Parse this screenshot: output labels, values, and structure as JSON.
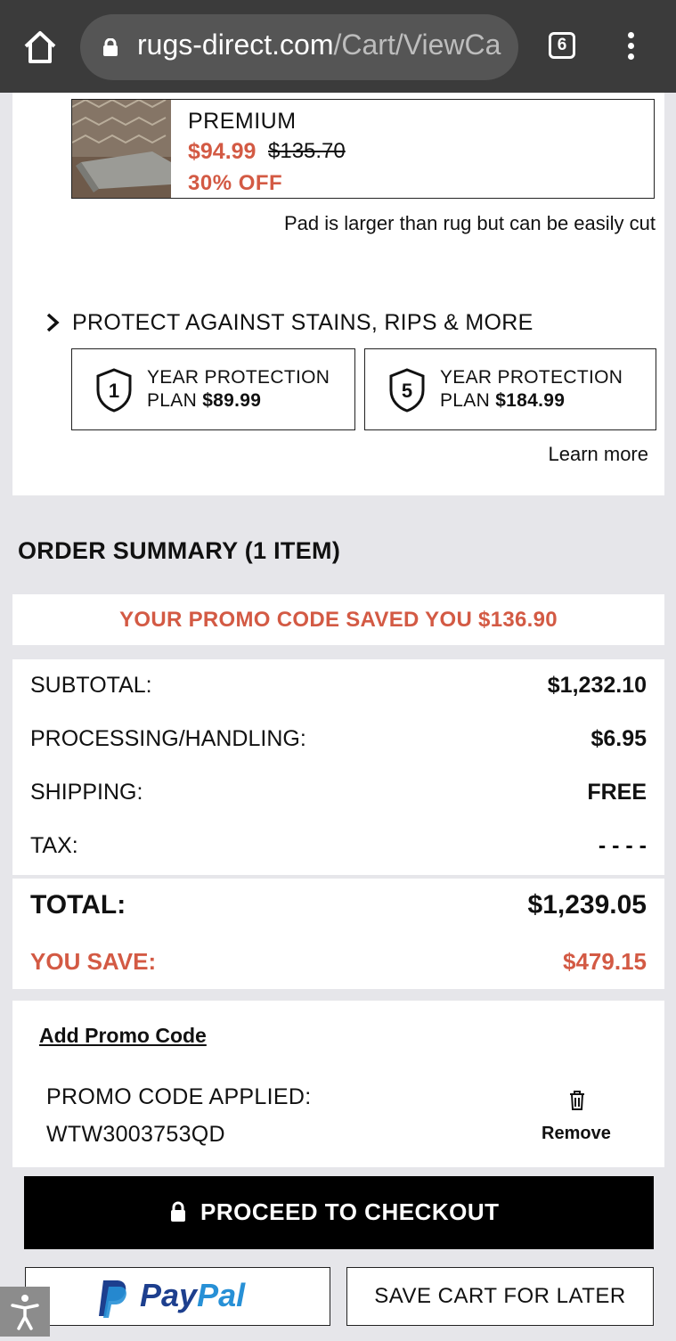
{
  "browser": {
    "url_host": "rugs-direct.com",
    "url_path": "/Cart/ViewCa",
    "tab_count": "6"
  },
  "product_addon": {
    "name": "PREMIUM",
    "price": "$94.99",
    "original_price": "$135.70",
    "discount": "30% OFF",
    "note": "Pad is larger than rug but can be easily cut"
  },
  "protection": {
    "heading": "PROTECT AGAINST STAINS, RIPS & MORE",
    "plans": [
      {
        "years": "1",
        "line1": "YEAR PROTECTION",
        "line2_label": "PLAN ",
        "price": "$89.99"
      },
      {
        "years": "5",
        "line1": "YEAR PROTECTION",
        "line2_label": "PLAN ",
        "price": "$184.99"
      }
    ],
    "learn_more": "Learn more"
  },
  "summary": {
    "title": "ORDER SUMMARY (1 ITEM)",
    "promo_saved": "YOUR PROMO CODE SAVED YOU $136.90",
    "rows": [
      {
        "label": "SUBTOTAL:",
        "value": "$1,232.10"
      },
      {
        "label": "PROCESSING/HANDLING:",
        "value": "$6.95"
      },
      {
        "label": "SHIPPING:",
        "value": "FREE"
      },
      {
        "label": "TAX:",
        "value": "- - - -"
      }
    ],
    "total_label": "TOTAL:",
    "total_value": "$1,239.05",
    "save_label": "YOU SAVE:",
    "save_value": "$479.15"
  },
  "promo": {
    "add_link": "Add Promo Code",
    "applied_label": "PROMO CODE APPLIED:",
    "applied_code": "WTW3003753QD",
    "remove_label": "Remove"
  },
  "actions": {
    "checkout": "PROCEED TO CHECKOUT",
    "paypal_pay": "Pay",
    "paypal_pal": "Pal",
    "save_later": "SAVE CART FOR LATER"
  },
  "colors": {
    "accent_red": "#d35a44",
    "paypal_dark": "#1d3f8e",
    "paypal_light": "#2790d6"
  }
}
